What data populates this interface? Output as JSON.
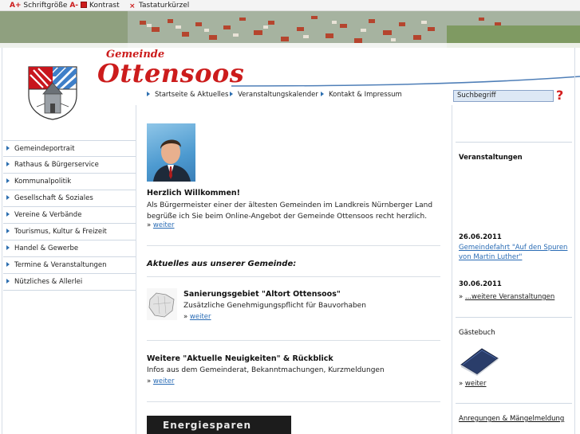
{
  "topbar": {
    "font_size_label": "Schriftgröße",
    "font_up": "A+",
    "font_down": "A-",
    "contrast": "Kontrast",
    "shortcuts": "Tastaturkürzel"
  },
  "header": {
    "logo_small": "Gemeinde",
    "logo_big": "Ottensoos"
  },
  "topnav": {
    "items": [
      "Startseite & Aktuelles",
      "Veranstaltungskalender",
      "Kontakt & Impressum"
    ]
  },
  "search": {
    "value": "Suchbegriff"
  },
  "help": {
    "symbol": "?"
  },
  "sidebar": {
    "items": [
      "Gemeindeportrait",
      "Rathaus & Bürgerservice",
      "Kommunalpolitik",
      "Gesellschaft & Soziales",
      "Vereine & Verbände",
      "Tourismus, Kultur & Freizeit",
      "Handel & Gewerbe",
      "Termine & Veranstaltungen",
      "Nützliches & Allerlei"
    ]
  },
  "welcome": {
    "title": "Herzlich Willkommen!",
    "text": "Als Bürgermeister einer der ältesten Gemeinden im Landkreis Nürnberger Land begrüße ich Sie beim Online-Angebot der Gemeinde Ottensoos recht herzlich.",
    "more_prefix": "»",
    "more": "weiter"
  },
  "news": {
    "heading": "Aktuelles aus unserer Gemeinde:",
    "item1_title": "Sanierungsgebiet \"Altort Ottensoos\"",
    "item1_text": "Zusätzliche Genehmigungspflicht für Bauvorhaben",
    "item1_more": "weiter",
    "item2_title": "Weitere \"Aktuelle Neuigkeiten\" & Rückblick",
    "item2_text": "Infos aus dem Gemeinderat, Bekanntmachungen, Kurzmeldungen",
    "item2_more": "weiter"
  },
  "banner_energy": "Energiesparen",
  "right": {
    "events_heading": "Veranstaltungen",
    "event1_date": "26.06.2011",
    "event1_title": "Gemeindefahrt \"Auf den Spuren von Martin Luther\"",
    "event2_date": "30.06.2011",
    "more_events": "...weitere Veranstaltungen",
    "guestbook_heading": "Gästebuch",
    "guestbook_more": "weiter",
    "suggestions_heading": "Anregungen & Mängelmeldung"
  },
  "colors": {
    "brand_red": "#cc1c1c",
    "link_blue": "#2a6cb5",
    "nav_arrow": "#2d6fb0"
  }
}
